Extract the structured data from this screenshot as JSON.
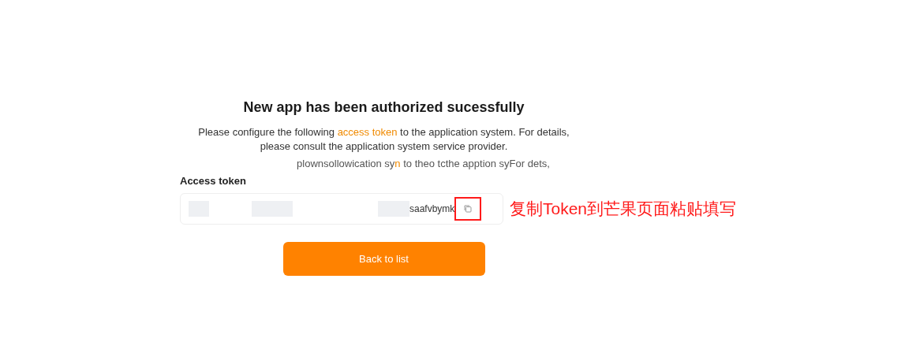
{
  "title": "New app has been authorized sucessfully",
  "description": [
    {
      "text": "Please configure the following ",
      "highlight": false
    },
    {
      "text": "access token",
      "highlight": true
    },
    {
      "text": " to the application system. For details, please consult the application system service provider.",
      "highlight": false
    }
  ],
  "ghost_line": [
    {
      "text": "plownsollowication sy",
      "highlight": false
    },
    {
      "text": "n",
      "highlight": true
    },
    {
      "text": " to theo tcthe apption syFor dets,",
      "highlight": false
    }
  ],
  "token": {
    "label": "Access token",
    "value": "saafvbymk"
  },
  "annotation": {
    "text": "复制Token到芒果页面粘贴填写",
    "color": "#ff1a1a"
  },
  "button": {
    "label": "Back to list"
  }
}
